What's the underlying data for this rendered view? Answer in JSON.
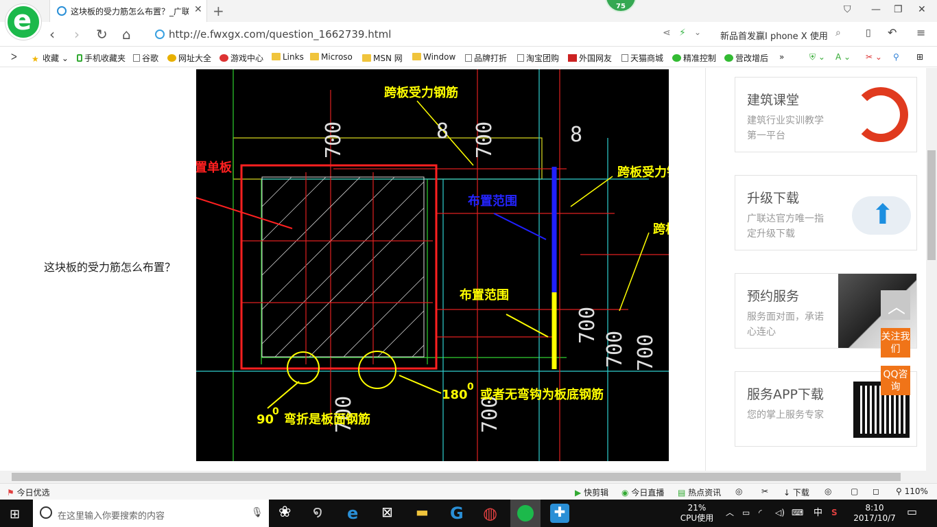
{
  "tab": {
    "title": "这块板的受力筋怎么布置？_广联"
  },
  "badge": "75",
  "address": {
    "url": "http://e.fwxgx.com/question_1662739.html"
  },
  "search": {
    "text": "新品首发赢I phone X 使用"
  },
  "bookmarks": [
    "收藏",
    "手机收藏夹",
    "谷歌",
    "网址大全",
    "游戏中心",
    "Links",
    "Microso",
    "MSN 网",
    "Window",
    "品牌打折",
    "淘宝团购",
    "外国网友",
    "天猫商城",
    "精准控制",
    "营改增后"
  ],
  "question": "这块板的受力筋怎么布置？",
  "cad": {
    "ann_red": "这是双层双向布置单板",
    "ann_top": "跨板受力钢筋",
    "ann_right1": "跨板受力钢筋",
    "ann_right2": "跨板受力钢筋",
    "ann_blue": "布置范围",
    "ann_yellow": "布置范围",
    "ann_bottom1_num": "90",
    "ann_bottom1_sup": "0",
    "ann_bottom1_text": "弯折是板面钢筋",
    "ann_bottom2_num": "180",
    "ann_bottom2_sup": "0",
    "ann_bottom2_text": "或者无弯钩为板底钢筋",
    "dims": [
      "700",
      "700",
      "700",
      "700",
      "700",
      "700",
      "700",
      "8",
      "8"
    ]
  },
  "cards": [
    {
      "title": "建筑课堂",
      "desc": "建筑行业实训教学第一平台",
      "icon": "logo-icon"
    },
    {
      "title": "升级下载",
      "desc": "广联达官方唯一指定升级下载",
      "icon": "cloud-upload-icon"
    },
    {
      "title": "预约服务",
      "desc": "服务面对面，承诺心连心",
      "icon": "handshake-icon"
    },
    {
      "title": "服务APP下载",
      "desc": "您的掌上服务专家",
      "icon": "qrcode-icon"
    }
  ],
  "float": {
    "follow": "关注我们",
    "qq": "QQ咨询"
  },
  "status": {
    "left": "今日优选",
    "items": [
      "快剪辑",
      "今日直播",
      "热点资讯",
      "下载"
    ],
    "zoom": "110%"
  },
  "taskbar": {
    "search_placeholder": "在这里输入你要搜索的内容",
    "cpu_pct": "21%",
    "cpu_label": "CPU使用",
    "ime": "中",
    "time": "8:10",
    "date": "2017/10/7"
  },
  "colors": {
    "accent_green": "#1cb94b",
    "cad_bg": "#000000",
    "ann_red": "#ff2020",
    "ann_yellow": "#ffff00",
    "ann_blue": "#2020ff",
    "float_orange": "#f07418"
  }
}
